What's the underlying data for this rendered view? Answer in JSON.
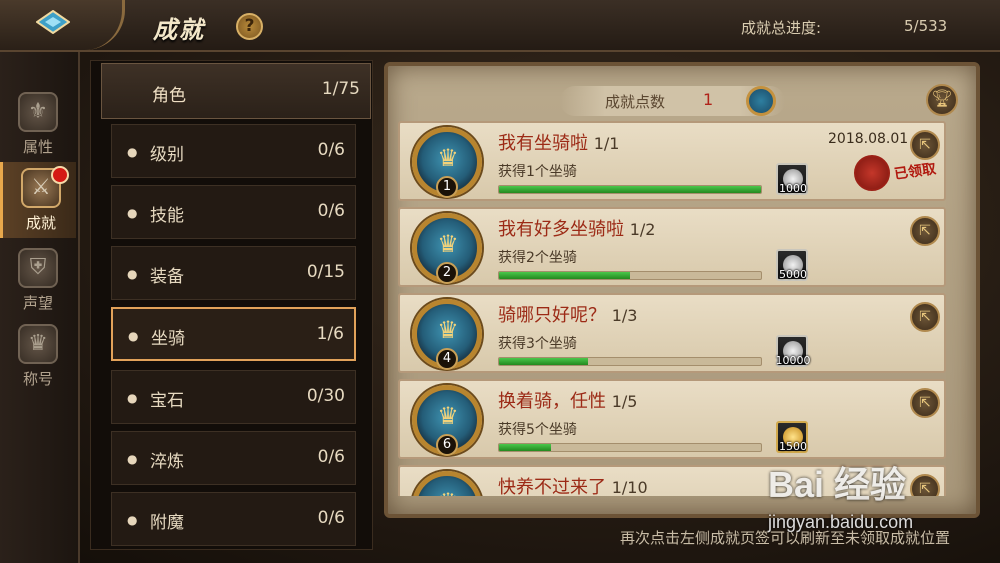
{
  "header": {
    "title": "成就",
    "help": "?",
    "total_progress_label": "成就总进度:",
    "total_progress_value": "5/533"
  },
  "leftnav": [
    {
      "label": "属性",
      "icon": "attributes-icon",
      "glyph": "⚜",
      "active": false
    },
    {
      "label": "成就",
      "icon": "achievement-icon",
      "glyph": "⚔",
      "active": true,
      "badge": true
    },
    {
      "label": "声望",
      "icon": "reputation-icon",
      "glyph": "⛨",
      "active": false
    },
    {
      "label": "称号",
      "icon": "title-icon",
      "glyph": "♛",
      "active": false
    }
  ],
  "categories": {
    "parent": {
      "name": "角色",
      "count": "1/75"
    },
    "items": [
      {
        "name": "级别",
        "count": "0/6"
      },
      {
        "name": "技能",
        "count": "0/6"
      },
      {
        "name": "装备",
        "count": "0/15"
      },
      {
        "name": "坐骑",
        "count": "1/6"
      },
      {
        "name": "宝石",
        "count": "0/30"
      },
      {
        "name": "淬炼",
        "count": "0/6"
      },
      {
        "name": "附魔",
        "count": "0/6"
      }
    ],
    "selected": "坐骑"
  },
  "points": {
    "label": "成就点数",
    "value": "1"
  },
  "achievements": [
    {
      "name": "我有坐骑啦",
      "progress": "1/1",
      "level": "1",
      "desc": "获得1个坐骑",
      "fill": 1.0,
      "reward": "1000",
      "reward_type": "silver",
      "date": "2018.08.01",
      "claimed": "已领取"
    },
    {
      "name": "我有好多坐骑啦",
      "progress": "1/2",
      "level": "2",
      "desc": "获得2个坐骑",
      "fill": 0.5,
      "reward": "5000",
      "reward_type": "silver",
      "date": "",
      "claimed": ""
    },
    {
      "name": "骑哪只好呢？",
      "progress": "1/3",
      "level": "4",
      "desc": "获得3个坐骑",
      "fill": 0.34,
      "reward": "10000",
      "reward_type": "silver",
      "date": "",
      "claimed": ""
    },
    {
      "name": "换着骑，任性",
      "progress": "1/5",
      "level": "6",
      "desc": "获得5个坐骑",
      "fill": 0.2,
      "reward": "1500",
      "reward_type": "gold",
      "date": "",
      "claimed": ""
    },
    {
      "name": "快养不过来了",
      "progress": "1/10",
      "level": "",
      "desc": "",
      "fill": 0.1,
      "reward": "",
      "reward_type": "",
      "date": "",
      "claimed": ""
    }
  ],
  "footer": "再次点击左侧成就页签可以刷新至未领取成就位置",
  "watermark": {
    "logo": "Bai 经验",
    "url": "jingyan.baidu.com"
  },
  "colors": {
    "accent": "#e2a25a",
    "progress": "#3fb83a",
    "title_red": "#9c2a16"
  }
}
